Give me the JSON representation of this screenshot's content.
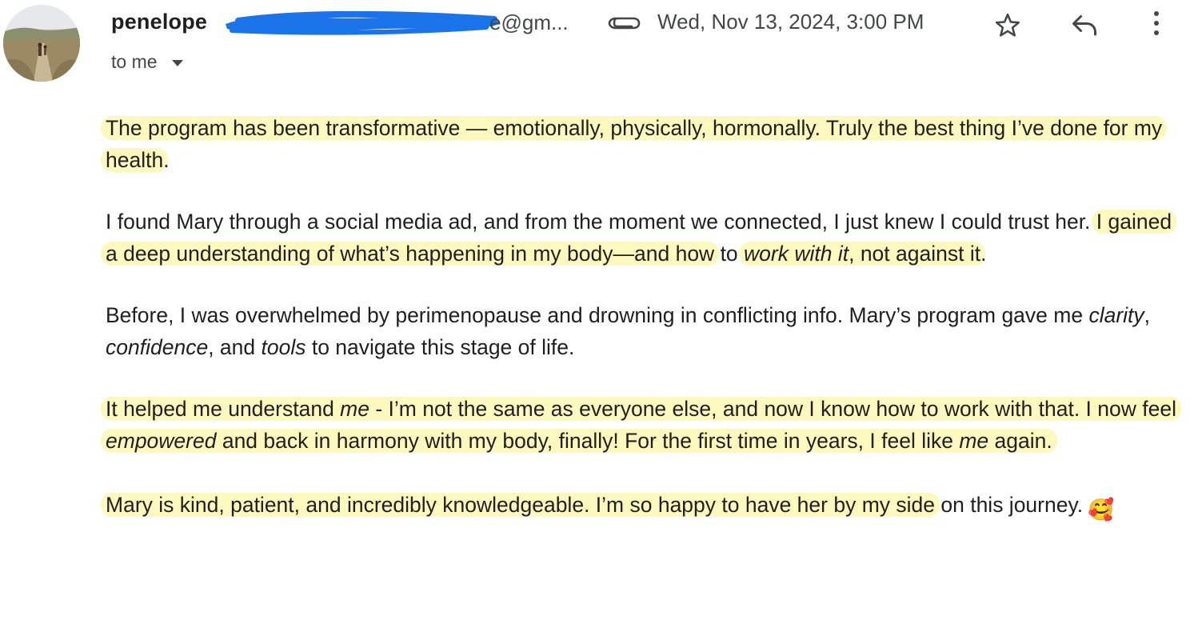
{
  "header": {
    "sender_name": "penelope",
    "sender_email_visible": "e@gm...",
    "date": "Wed, Nov 13, 2024, 3:00 PM",
    "recipient_label": "to me"
  },
  "icons": {
    "avatar": "avatar-photo",
    "attachment": "paperclip-icon",
    "star": "star-icon",
    "reply": "reply-icon",
    "more": "more-vertical-icon",
    "caret": "caret-down-icon"
  },
  "colors": {
    "highlight": "#fdf7b2",
    "text": "#1f1f1f",
    "secondary_text": "#444746",
    "redaction": "#1a73e8"
  },
  "body": {
    "p1": {
      "h1": "The program has been transformative — emotionally, physically, hormonally. Truly the best thing I’ve done for my health",
      "t1": "."
    },
    "p2": {
      "t1": "I found Mary through a social media ad, and from the moment we connected, I just knew I could trust her. ",
      "h1": "I gained a deep understanding of what’s happening in my body—and how",
      "t2": " to ",
      "h2_em": "work with it",
      "h2": ", not against it",
      "t3": "."
    },
    "p3": {
      "t1": "Before, I was overwhelmed by perimenopause and drowning in conflicting info. Mary’s program gave me ",
      "em1": "clarity",
      "t2": ", ",
      "em2": "confidence",
      "t3": ", and ",
      "em3": "tools",
      "t4": " to navigate this stage of life."
    },
    "p4": {
      "t1": "It helped me understand ",
      "em1": "me",
      "t2": " - I’m not the same as everyone else, and now I know how to work with that. I now feel ",
      "em2": "empowered",
      "t3": " and back in harmony with my body, finally! For the first time in years, I feel like ",
      "em3": "me",
      "t4": " again."
    },
    "p5": {
      "h1": "Mary is kind, patient, and incredibly knowledgeable. I’m so happy to have her by my side",
      "t1": " on this journey.",
      "emoji": "🥰"
    }
  }
}
